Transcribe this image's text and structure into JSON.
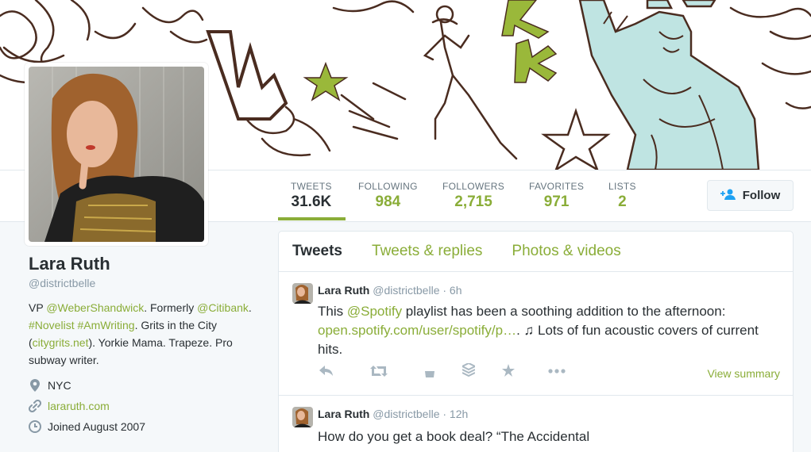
{
  "profile": {
    "name": "Lara Ruth",
    "handle": "@districtbelle",
    "bio": {
      "t1": "VP ",
      "m1": "@WeberShandwick",
      "t2": ". Formerly ",
      "m2": "@Citibank",
      "t3": ". ",
      "h1": "#Novelist",
      "t4": " ",
      "h2": "#AmWriting",
      "t5": ". Grits in the City (",
      "l1": "citygrits.net",
      "t6": "). Yorkie Mama. Trapeze. Pro subway writer."
    },
    "location": "NYC",
    "website": "lararuth.com",
    "joined": "Joined August 2007"
  },
  "stats": [
    {
      "label": "TWEETS",
      "value": "31.6K"
    },
    {
      "label": "FOLLOWING",
      "value": "984"
    },
    {
      "label": "FOLLOWERS",
      "value": "2,715"
    },
    {
      "label": "FAVORITES",
      "value": "971"
    },
    {
      "label": "LISTS",
      "value": "2"
    }
  ],
  "follow_label": "Follow",
  "tabs": [
    "Tweets",
    "Tweets & replies",
    "Photos & videos"
  ],
  "tweets": [
    {
      "name": "Lara Ruth",
      "handle": "@districtbelle",
      "time": "· 6h",
      "p1": "This ",
      "mention": "@Spotify",
      "p2": " playlist has been a soothing addition to the afternoon: ",
      "link": "open.spotify.com/user/spotify/p…",
      "p3": ". ♫ Lots of fun acoustic covers of current hits.",
      "view_summary": "View summary"
    },
    {
      "name": "Lara Ruth",
      "handle": "@districtbelle",
      "time": "· 12h",
      "text": "How do you get a book deal? “The Accidental"
    }
  ],
  "colors": {
    "accent": "#8aad38",
    "banner_ink": "#4a2c20",
    "banner_green": "#9ab83a",
    "banner_blue": "#bfe4e2"
  },
  "icons": [
    "location-icon",
    "link-icon",
    "calendar-icon",
    "reply-icon",
    "retweet-icon",
    "bucket-icon",
    "stack-icon",
    "star-icon",
    "more-icon",
    "add-user-icon"
  ]
}
